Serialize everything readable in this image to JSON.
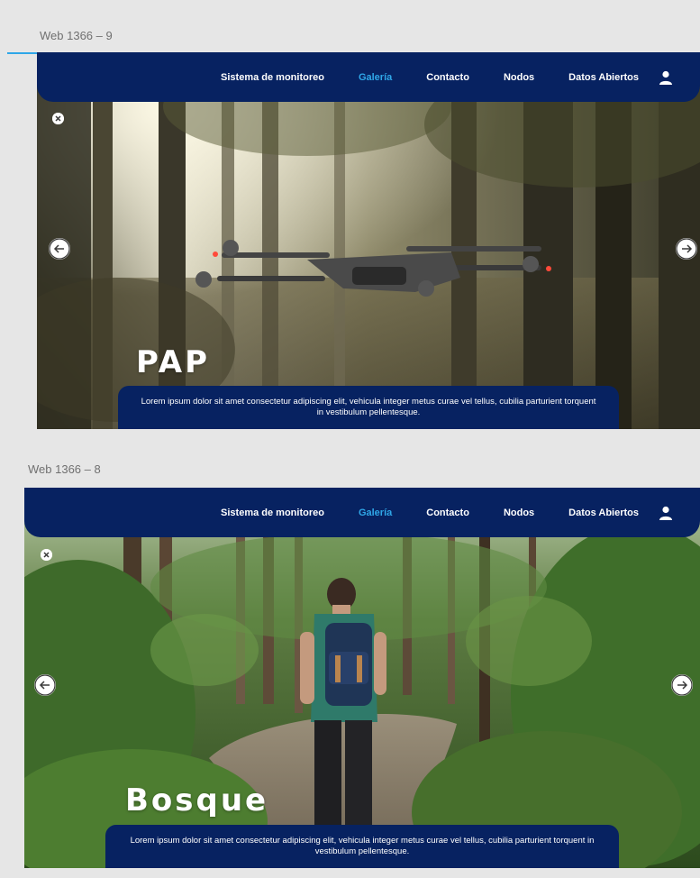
{
  "colors": {
    "navy": "#072261",
    "accent": "#2fa7e8",
    "canvas": "#e6e6e6"
  },
  "artboards": [
    {
      "label": "Web 1366 – 9",
      "nav": {
        "items": [
          "Sistema de monitoreo",
          "Galería",
          "Contacto",
          "Nodos",
          "Datos Abiertos"
        ],
        "active": "Galería",
        "user_icon": "user-icon"
      },
      "close_icon": "close-icon",
      "prev_icon": "arrow-left-icon",
      "next_icon": "arrow-right-icon",
      "title": "PAP",
      "caption": "Lorem ipsum dolor sit amet consectetur adipiscing elit, vehicula integer metus curae vel tellus, cubilia parturient torquent in vestibulum pellentesque.",
      "scene": "forest-with-drone"
    },
    {
      "label": "Web 1366 – 8",
      "nav": {
        "items": [
          "Sistema de monitoreo",
          "Galería",
          "Contacto",
          "Nodos",
          "Datos Abiertos"
        ],
        "active": "Galería",
        "user_icon": "user-icon"
      },
      "close_icon": "close-icon",
      "prev_icon": "arrow-left-icon",
      "next_icon": "arrow-right-icon",
      "title": "Bosque",
      "caption": "Lorem ipsum dolor sit amet consectetur adipiscing elit, vehicula integer metus curae vel tellus, cubilia parturient torquent in vestibulum pellentesque.",
      "scene": "hiker-in-green-forest"
    }
  ]
}
